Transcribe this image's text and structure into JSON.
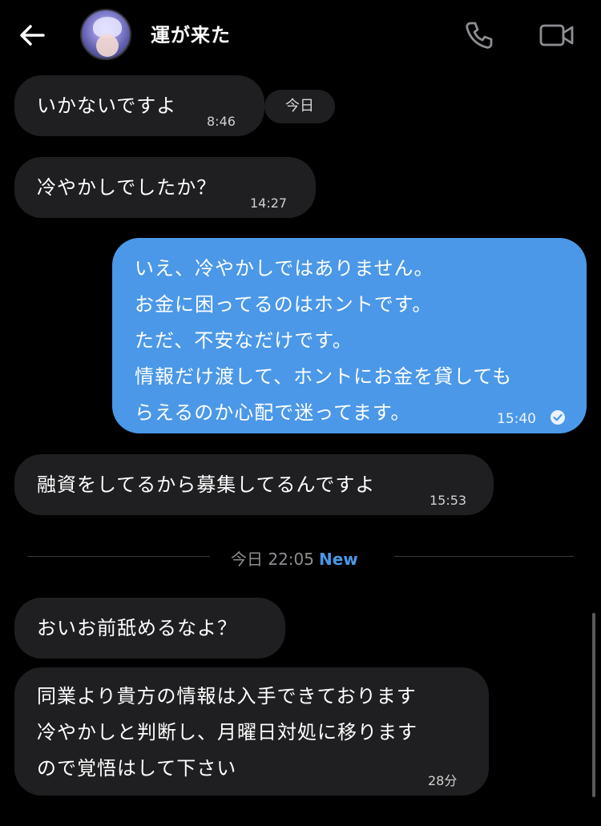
{
  "header": {
    "contact_name": "運が来た"
  },
  "messages": [
    {
      "text": "いかないですよ",
      "time": "8:46"
    },
    {
      "text": "冷やかしでしたか？",
      "time": "14:27"
    },
    {
      "lines": [
        "いえ、冷やかしではありません。",
        "お金に困ってるのはホントです。",
        "ただ、不安なだけです。",
        "情報だけ渡して、ホントにお金を貸しても",
        "らえるのか心配で迷ってます。"
      ],
      "time": "15:40"
    },
    {
      "text": "融資をしてるから募集してるんですよ",
      "time": "15:53"
    },
    {
      "text": "おいお前舐めるなよ？"
    },
    {
      "lines": [
        "同業より貴方の情報は入手できております",
        "冷やかしと判断し、月曜日対処に移ります",
        "ので覚悟はして下さい"
      ],
      "time": "28分"
    }
  ],
  "date_pill": "今日",
  "divider": {
    "label": "今日 22:05",
    "new_label": "New"
  },
  "colors": {
    "outgoing": "#4b98e8",
    "incoming": "#1f1f21",
    "background": "#000000"
  }
}
